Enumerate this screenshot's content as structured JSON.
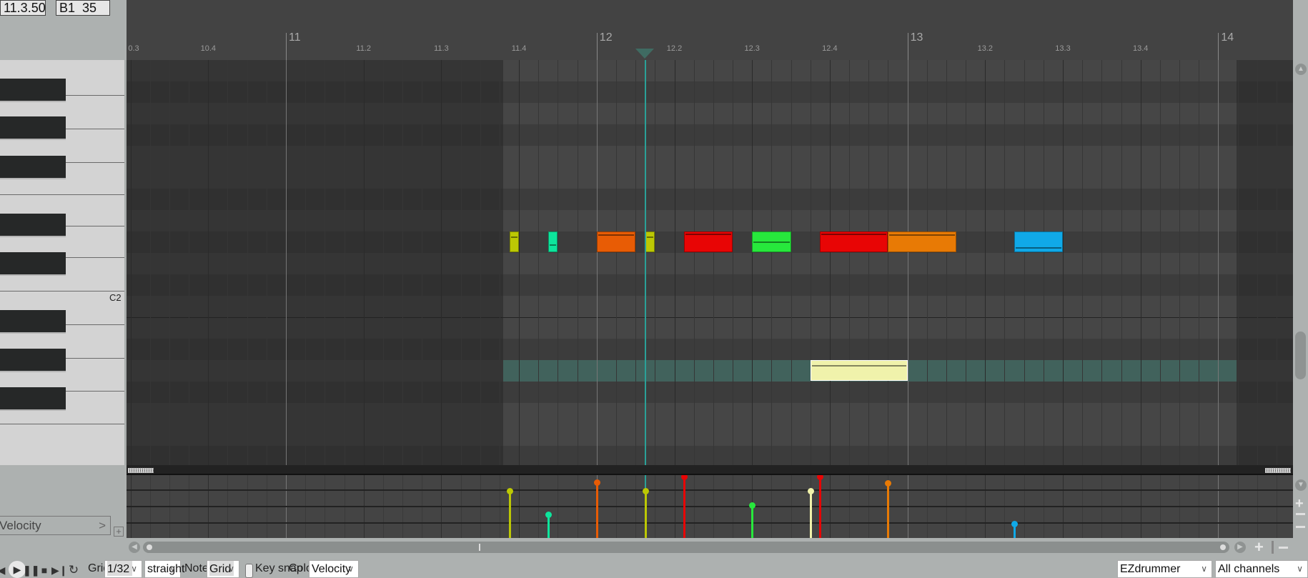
{
  "header": {
    "position": "11.3.50",
    "note_info": "B1  35"
  },
  "ruler": {
    "major": [
      {
        "bar": 11,
        "label": "11"
      },
      {
        "bar": 12,
        "label": "12"
      },
      {
        "bar": 13,
        "label": "13"
      },
      {
        "bar": 14,
        "label": "14"
      }
    ],
    "minor": [
      {
        "bar": 10.5,
        "label": "0.3"
      },
      {
        "bar": 10.75,
        "label": "10.4"
      },
      {
        "bar": 11.25,
        "label": "11.2"
      },
      {
        "bar": 11.5,
        "label": "11.3"
      },
      {
        "bar": 11.75,
        "label": "11.4"
      },
      {
        "bar": 12.25,
        "label": "12.2"
      },
      {
        "bar": 12.5,
        "label": "12.3"
      },
      {
        "bar": 12.75,
        "label": "12.4"
      },
      {
        "bar": 13.25,
        "label": "13.2"
      },
      {
        "bar": 13.5,
        "label": "13.3"
      },
      {
        "bar": 13.75,
        "label": "13.4"
      }
    ]
  },
  "playhead_bar": 12.155,
  "item_range": [
    11.7,
    14.06
  ],
  "piano": {
    "label": "C2"
  },
  "notes": [
    {
      "start": 11.71875,
      "end": 11.75,
      "row": 8,
      "color": "#bcc804",
      "velocity": 97
    },
    {
      "start": 11.84375,
      "end": 11.875,
      "row": 8,
      "color": "#0de59c",
      "velocity": 49
    },
    {
      "start": 12.0,
      "end": 12.125,
      "row": 8,
      "color": "#e85c05",
      "velocity": 115
    },
    {
      "start": 12.15625,
      "end": 12.1875,
      "row": 8,
      "color": "#bcc804",
      "velocity": 97
    },
    {
      "start": 12.28125,
      "end": 12.4375,
      "row": 8,
      "color": "#e80505",
      "velocity": 127
    },
    {
      "start": 12.5,
      "end": 12.625,
      "row": 8,
      "color": "#27e83c",
      "velocity": 68
    },
    {
      "start": 12.6875,
      "end": 13.0,
      "row": 14,
      "color": "#f0f2ab",
      "velocity": 97,
      "selected": true
    },
    {
      "start": 12.71875,
      "end": 12.9375,
      "row": 8,
      "color": "#e80505",
      "velocity": 127
    },
    {
      "start": 12.9375,
      "end": 13.15625,
      "row": 8,
      "color": "#e87a05",
      "velocity": 114
    },
    {
      "start": 13.34375,
      "end": 13.5,
      "row": 8,
      "color": "#10a9e8",
      "velocity": 29
    }
  ],
  "highlight_row": 14,
  "lane": {
    "label": "Velocity",
    "expand_icon": "chevron-right-icon",
    "add_icon": "plus-box-icon"
  },
  "toolbar": {
    "grid_label": "Grid:",
    "grid_value": "1/32",
    "grid_type": "straight",
    "notes_label": "Notes:",
    "notes_value": "Grid",
    "key_snap_label": "Key snap",
    "key_snap_checked": false,
    "color_label": "Color:",
    "color_value": "Velocity",
    "instrument": "EZdrummer",
    "channel": "All channels"
  },
  "colors": {
    "playhead": "#2aa198",
    "highlight_row": "#41625c",
    "accent": "#adb1b0"
  }
}
